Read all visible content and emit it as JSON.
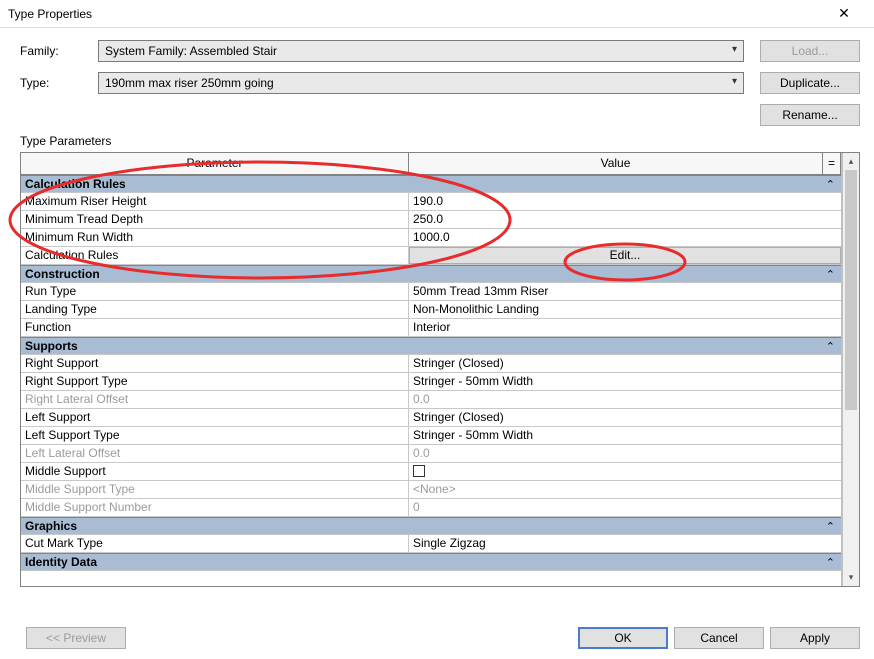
{
  "window": {
    "title": "Type Properties"
  },
  "top": {
    "family_label": "Family:",
    "family_value": "System Family: Assembled Stair",
    "type_label": "Type:",
    "type_value": "190mm max riser 250mm going",
    "load_btn": "Load...",
    "duplicate_btn": "Duplicate...",
    "rename_btn": "Rename..."
  },
  "section_label": "Type Parameters",
  "headers": {
    "param": "Parameter",
    "value": "Value",
    "eq": "="
  },
  "groups": {
    "calc": {
      "title": "Calculation Rules",
      "rows": [
        {
          "name": "Maximum Riser Height",
          "value": "190.0"
        },
        {
          "name": "Minimum Tread Depth",
          "value": "250.0"
        },
        {
          "name": "Minimum Run Width",
          "value": "1000.0"
        },
        {
          "name": "Calculation Rules",
          "button": "Edit..."
        }
      ]
    },
    "constr": {
      "title": "Construction",
      "rows": [
        {
          "name": "Run Type",
          "value": "50mm Tread 13mm Riser"
        },
        {
          "name": "Landing Type",
          "value": "Non-Monolithic Landing"
        },
        {
          "name": "Function",
          "value": "Interior"
        }
      ]
    },
    "supports": {
      "title": "Supports",
      "rows": [
        {
          "name": "Right Support",
          "value": "Stringer (Closed)"
        },
        {
          "name": "Right Support Type",
          "value": "Stringer - 50mm Width"
        },
        {
          "name": "Right Lateral Offset",
          "value": "0.0",
          "disabled": true
        },
        {
          "name": "Left Support",
          "value": "Stringer (Closed)"
        },
        {
          "name": "Left Support Type",
          "value": "Stringer - 50mm Width"
        },
        {
          "name": "Left Lateral Offset",
          "value": "0.0",
          "disabled": true
        },
        {
          "name": "Middle Support",
          "checkbox": true
        },
        {
          "name": "Middle Support Type",
          "value": "<None>",
          "disabled": true
        },
        {
          "name": "Middle Support Number",
          "value": "0",
          "disabled": true
        }
      ]
    },
    "graphics": {
      "title": "Graphics",
      "rows": [
        {
          "name": "Cut Mark Type",
          "value": "Single Zigzag"
        }
      ]
    },
    "identity": {
      "title": "Identity Data"
    }
  },
  "footer": {
    "preview": "<< Preview",
    "ok": "OK",
    "cancel": "Cancel",
    "apply": "Apply"
  }
}
